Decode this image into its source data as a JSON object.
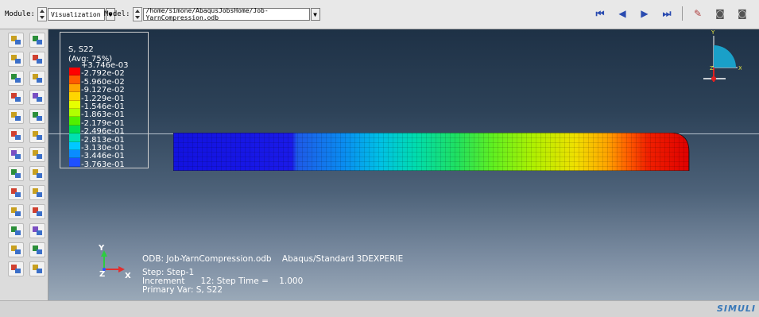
{
  "toolbar": {
    "module_label": "Module:",
    "module_value": "Visualization",
    "model_label": "Model:",
    "model_value": "/home/simone/AbaqusJobsHome/Job-YarnCompression.odb",
    "playback_icons": [
      "first-frame-icon",
      "previous-frame-icon",
      "next-frame-icon",
      "last-frame-icon"
    ],
    "right_icons": [
      "animation-options-icon",
      "camera-icon",
      "camera-options-icon"
    ]
  },
  "legend": {
    "title_line1": "S, S22",
    "title_line2": "(Avg: 75%)",
    "values": [
      "+3.746e-03",
      "-2.792e-02",
      "-5.960e-02",
      "-9.127e-02",
      "-1.229e-01",
      "-1.546e-01",
      "-1.863e-01",
      "-2.179e-01",
      "-2.496e-01",
      "-2.813e-01",
      "-3.130e-01",
      "-3.446e-01",
      "-3.763e-01"
    ],
    "colors": [
      "#ff0000",
      "#ff5a00",
      "#ffa500",
      "#ffd500",
      "#e6ff00",
      "#b0ff00",
      "#50f000",
      "#00e050",
      "#00e0b0",
      "#00c8ff",
      "#0a8cff",
      "#1e50ff",
      "#1a1aff"
    ]
  },
  "triad": {
    "x": "X",
    "y": "Y",
    "z": "Z"
  },
  "info": {
    "odb_line": "ODB: Job-YarnCompression.odb    Abaqus/Standard 3DEXPERIE",
    "step_line": "Step: Step-1",
    "increment_line": "Increment      12: Step Time =    1.000",
    "primary_var_line": "Primary Var: S, S22"
  },
  "status": {
    "brand": "SIMULI"
  }
}
